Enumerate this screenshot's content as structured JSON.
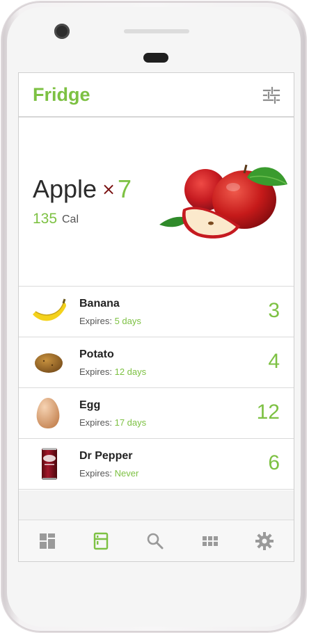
{
  "app": {
    "title": "Fridge"
  },
  "hero": {
    "name": "Apple",
    "times": "×",
    "count": "7",
    "calories": "135",
    "cal_unit": "Cal"
  },
  "items": [
    {
      "name": "Banana",
      "expires_label": "Expires:",
      "expires_value": "5 days",
      "count": "3",
      "icon": "banana-icon"
    },
    {
      "name": "Potato",
      "expires_label": "Expires:",
      "expires_value": "12 days",
      "count": "4",
      "icon": "potato-icon"
    },
    {
      "name": "Egg",
      "expires_label": "Expires:",
      "expires_value": "17 days",
      "count": "12",
      "icon": "egg-icon"
    },
    {
      "name": "Dr Pepper",
      "expires_label": "Expires:",
      "expires_value": "Never",
      "count": "6",
      "icon": "soda-can-icon"
    }
  ],
  "bottom_nav": [
    {
      "icon": "dashboard-icon",
      "active": false
    },
    {
      "icon": "fridge-icon",
      "active": true
    },
    {
      "icon": "search-icon",
      "active": false
    },
    {
      "icon": "grid-icon",
      "active": false
    },
    {
      "icon": "gear-icon",
      "active": false
    }
  ],
  "colors": {
    "accent": "#7dc143",
    "times": "#7a1212",
    "text": "#222222"
  }
}
